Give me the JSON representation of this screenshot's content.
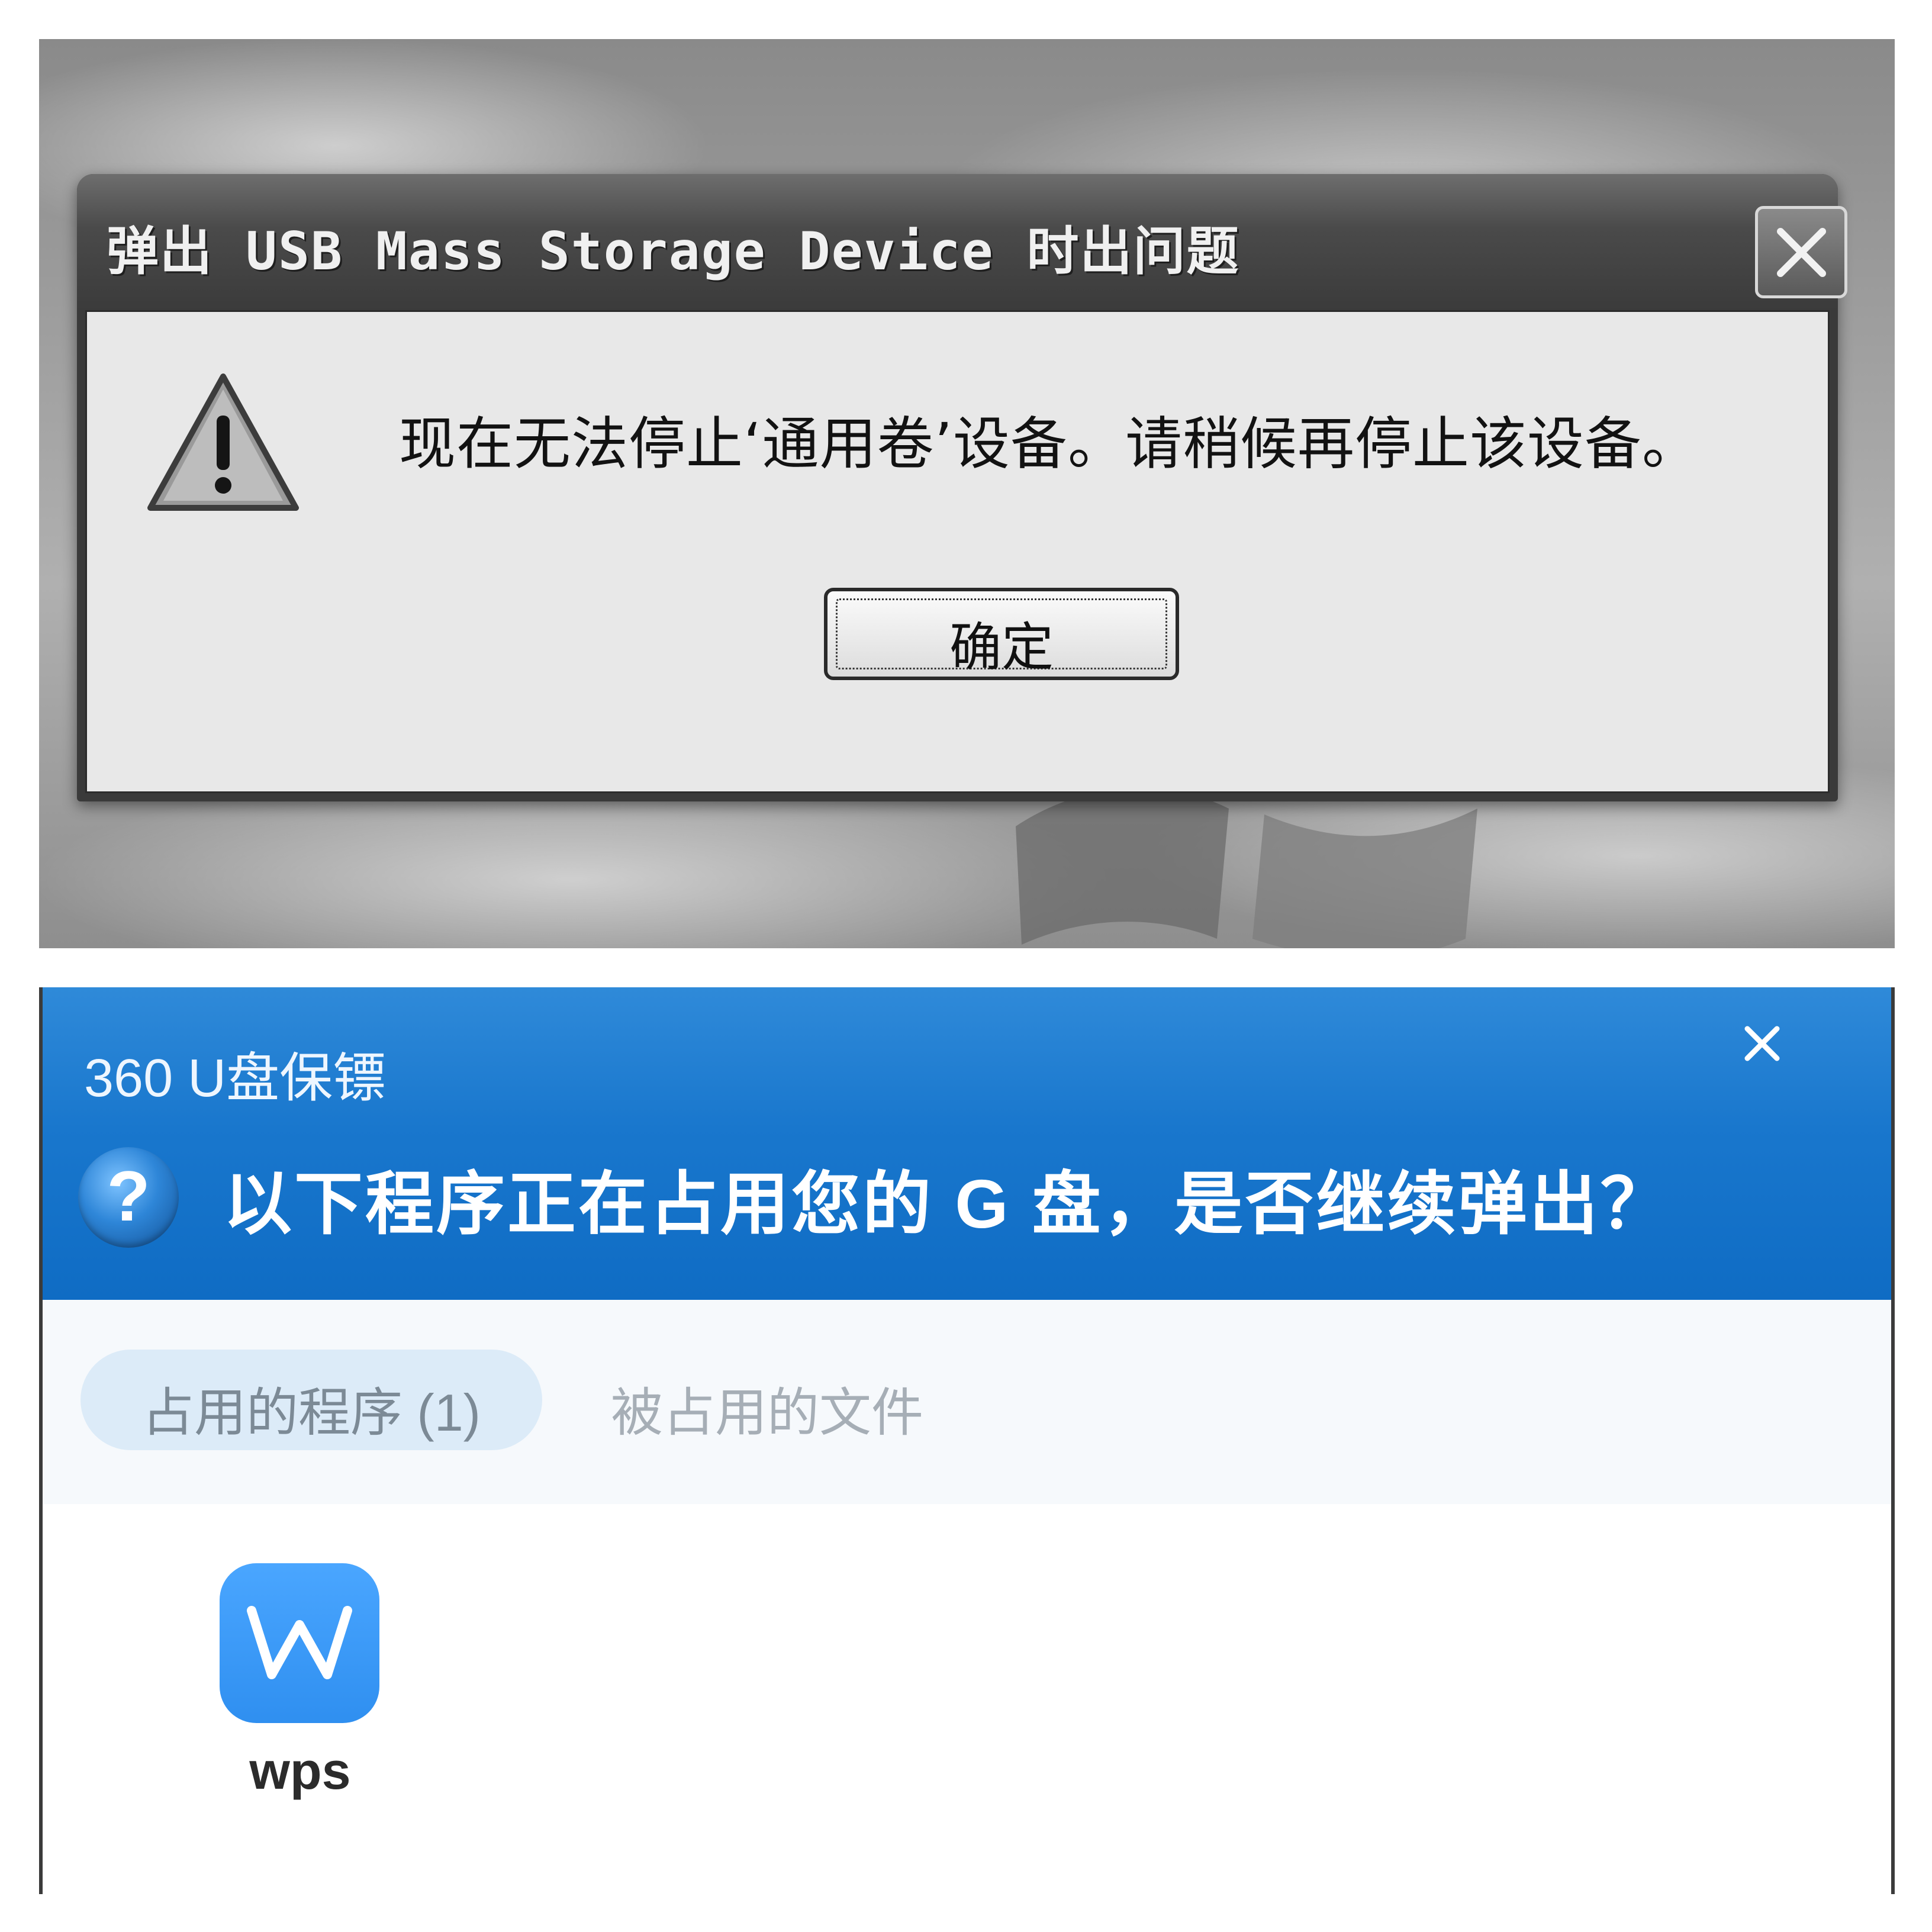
{
  "xp_dialog": {
    "title": "弹出 USB Mass Storage Device 时出问题",
    "message": "现在无法停止‘通用卷’设备。请稍候再停止该设备。",
    "ok_button": "确定",
    "icons": {
      "warning": "warning-triangle-icon",
      "close": "close-icon"
    }
  },
  "u360_dialog": {
    "app_name": "360 U盘保镖",
    "question": "以下程序正在占用您的 G 盘，是否继续弹出？",
    "tabs": [
      {
        "label": "占用的程序 (1)",
        "active": true
      },
      {
        "label": "被占用的文件",
        "active": false
      }
    ],
    "programs": [
      {
        "name": "wps",
        "icon": "wps-w-icon"
      }
    ],
    "icons": {
      "help": "help-question-icon",
      "close": "close-icon"
    },
    "colors": {
      "header": "#1977cd",
      "tab_active_bg": "#dcebf8",
      "app_icon": "#2f8ff0"
    }
  }
}
